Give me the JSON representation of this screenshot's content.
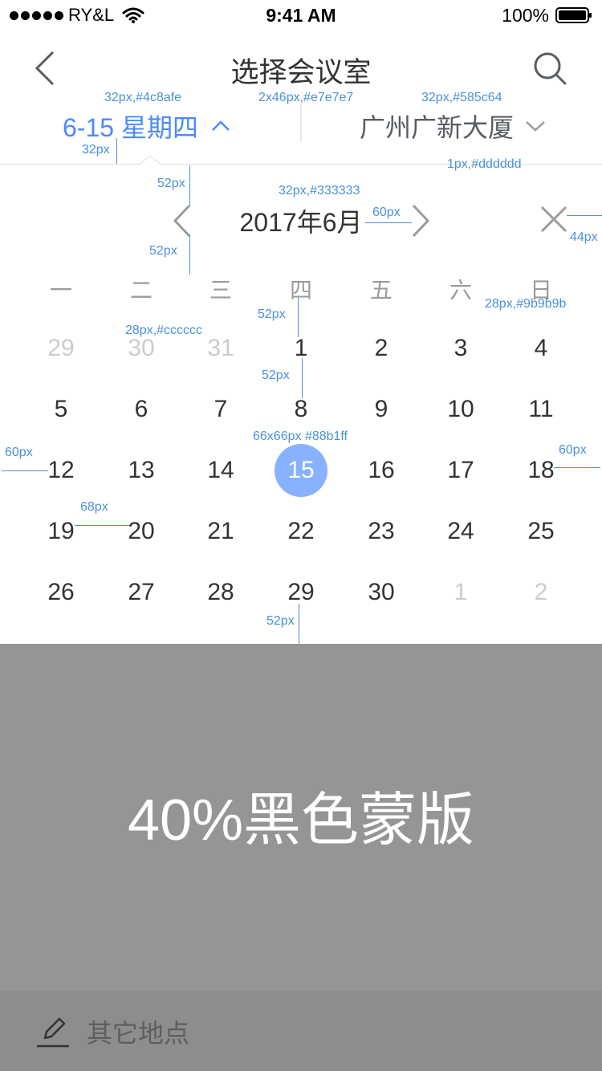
{
  "status_bar": {
    "carrier": "RY&L",
    "time": "9:41 AM",
    "battery": "100%"
  },
  "nav": {
    "title": "选择会议室"
  },
  "filters": {
    "date_label": "6-15 星期四",
    "location_label": "广州广新大厦"
  },
  "calendar": {
    "month_label": "2017年6月",
    "weekdays": [
      "一",
      "二",
      "三",
      "四",
      "五",
      "六",
      "日"
    ],
    "weeks": [
      [
        {
          "d": "29",
          "m": true
        },
        {
          "d": "30",
          "m": true
        },
        {
          "d": "31",
          "m": true
        },
        {
          "d": "1"
        },
        {
          "d": "2"
        },
        {
          "d": "3"
        },
        {
          "d": "4"
        }
      ],
      [
        {
          "d": "5"
        },
        {
          "d": "6"
        },
        {
          "d": "7"
        },
        {
          "d": "8"
        },
        {
          "d": "9"
        },
        {
          "d": "10"
        },
        {
          "d": "11"
        }
      ],
      [
        {
          "d": "12"
        },
        {
          "d": "13"
        },
        {
          "d": "14"
        },
        {
          "d": "15",
          "s": true
        },
        {
          "d": "16"
        },
        {
          "d": "17"
        },
        {
          "d": "18"
        }
      ],
      [
        {
          "d": "19"
        },
        {
          "d": "20"
        },
        {
          "d": "21"
        },
        {
          "d": "22"
        },
        {
          "d": "23"
        },
        {
          "d": "24"
        },
        {
          "d": "25"
        }
      ],
      [
        {
          "d": "26"
        },
        {
          "d": "27"
        },
        {
          "d": "28"
        },
        {
          "d": "29"
        },
        {
          "d": "30"
        },
        {
          "d": "1",
          "m": true
        },
        {
          "d": "2",
          "m": true
        }
      ]
    ]
  },
  "overlay": {
    "label": "40%黑色蒙版"
  },
  "bottom": {
    "other_location": "其它地点"
  },
  "spec_notes": {
    "date_font": "32px,#4c8afe",
    "divider": "2x46px,#e7e7e7",
    "location_font": "32px,#585c64",
    "line": "1px,#dddddd",
    "month_font": "32px,#333333",
    "weekday_font": "28px,#9b9b9b",
    "muted_font": "28px,#cccccc",
    "selected": "66x66px #88b1ff",
    "gap_32": "32px",
    "gap_52a": "52px",
    "gap_52b": "52px",
    "gap_52c": "52px",
    "gap_52d": "52px",
    "gap_52e": "52px",
    "gap_60a": "60px",
    "gap_60b": "60px",
    "gap_60c": "60px",
    "gap_44": "44px",
    "gap_68": "68px"
  },
  "colors": {
    "accent": "#4c8afe",
    "selected_day": "#88b1ff",
    "text": "#333333",
    "muted": "#cccccc",
    "weekday": "#9b9b9b",
    "mask": "#959595"
  }
}
